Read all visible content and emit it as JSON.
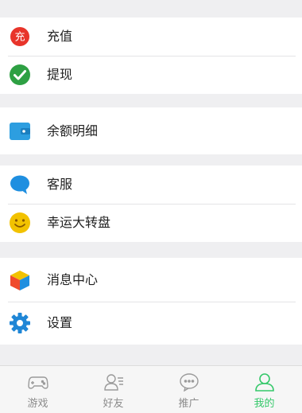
{
  "menu": {
    "recharge": {
      "icon": "recharge-icon",
      "badge_char": "充",
      "label": "充值",
      "color": "#e8342a"
    },
    "withdraw": {
      "icon": "check-circle-icon",
      "label": "提现",
      "color": "#2ea043"
    },
    "balance_detail": {
      "icon": "wallet-icon",
      "label": "余额明细",
      "color": "#2d9ee0"
    },
    "customer_service": {
      "icon": "chat-bubble-icon",
      "label": "客服",
      "color": "#1f8fe0"
    },
    "lucky_wheel": {
      "icon": "smiley-icon",
      "label": "幸运大转盘",
      "color": "#f2c200"
    },
    "messages": {
      "icon": "cube-icon",
      "label": "消息中心"
    },
    "settings": {
      "icon": "gear-icon",
      "label": "设置",
      "color": "#1f86d6"
    }
  },
  "tabbar": {
    "tabs": [
      {
        "icon": "gamepad-icon",
        "label": "游戏",
        "active": false
      },
      {
        "icon": "friends-icon",
        "label": "好友",
        "active": false
      },
      {
        "icon": "chat-dots-icon",
        "label": "推广",
        "active": false
      },
      {
        "icon": "user-icon",
        "label": "我的",
        "active": true
      }
    ],
    "active_color": "#35c86a",
    "inactive_color": "#8c8c8c"
  }
}
